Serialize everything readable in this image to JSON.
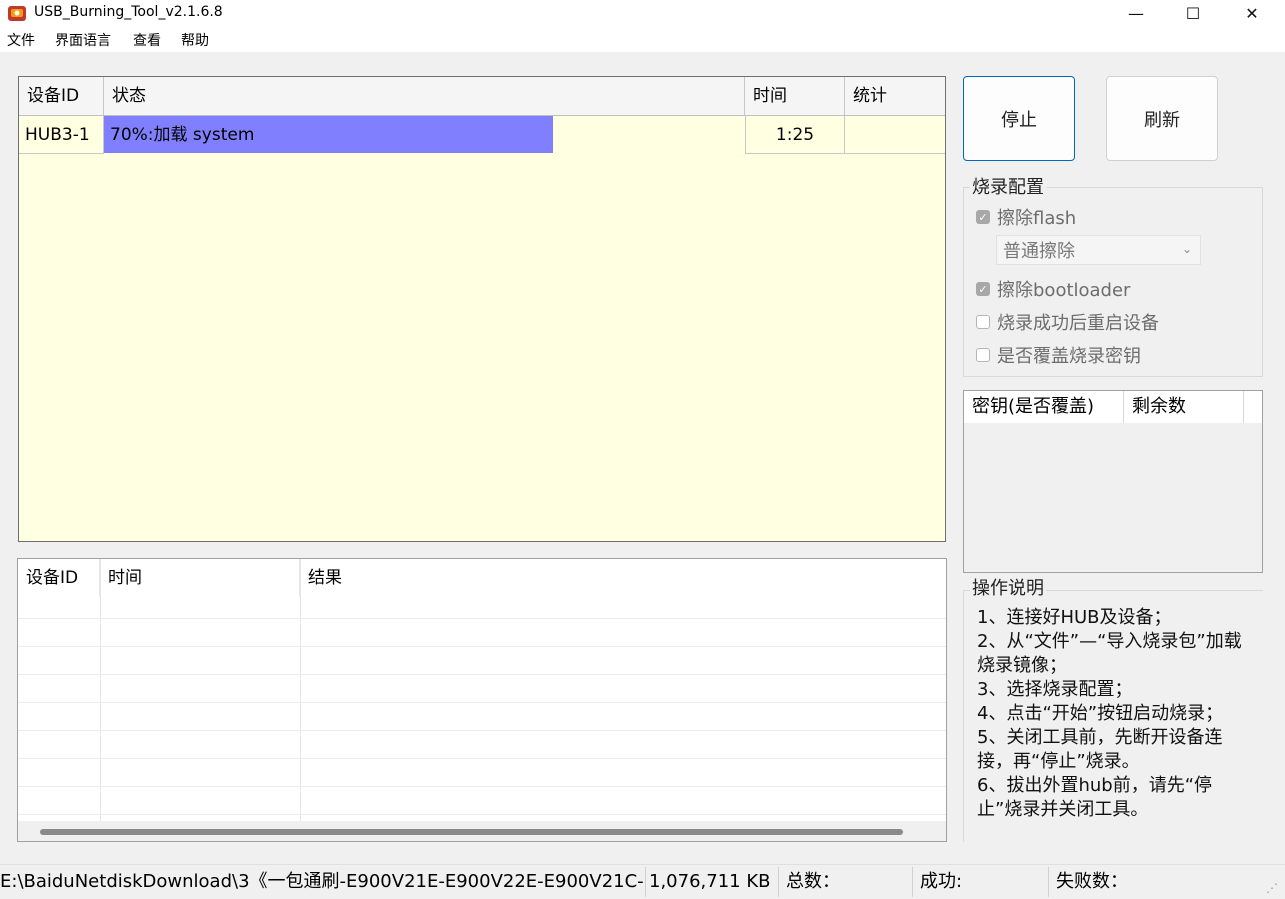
{
  "window": {
    "title": "USB_Burning_Tool_v2.1.6.8",
    "minimize_glyph": "—",
    "maximize_glyph": "☐",
    "close_glyph": "✕"
  },
  "menu": {
    "items": [
      "文件",
      "界面语言",
      "查看",
      "帮助"
    ]
  },
  "device_table": {
    "columns": [
      "设备ID",
      "状态",
      "时间",
      "统计"
    ],
    "rows": [
      {
        "device_id": "HUB3-1",
        "status": "70%:加载 system",
        "progress": 0.7,
        "time": "1:25",
        "stats": ""
      }
    ],
    "progress_color": "#8080ff",
    "background_color": "#ffffe1"
  },
  "result_table": {
    "columns": [
      "设备ID",
      "时间",
      "结果"
    ]
  },
  "buttons": {
    "stop": "停止",
    "refresh": "刷新"
  },
  "burn_config": {
    "title": "烧录配置",
    "erase_flash": {
      "label": "擦除flash",
      "checked": true
    },
    "erase_mode": "普通擦除",
    "erase_bootloader": {
      "label": "擦除bootloader",
      "checked": true
    },
    "reboot_after": {
      "label": "烧录成功后重启设备",
      "checked": false
    },
    "overwrite_key": {
      "label": "是否覆盖烧录密钥",
      "checked": false
    }
  },
  "key_table": {
    "columns": [
      "密钥(是否覆盖)",
      "剩余数"
    ]
  },
  "instructions": {
    "title": "操作说明",
    "lines": [
      "1、连接好HUB及设备；",
      "2、从“文件”—“导入烧录包”加载烧录镜像；",
      "3、选择烧录配置；",
      "4、点击“开始”按钮启动烧录；",
      "5、关闭工具前，先断开设备连接，再“停止”烧录。",
      "6、拔出外置hub前，请先“停止”烧录并关闭工具。"
    ]
  },
  "statusbar": {
    "path": "E:\\BaiduNetdiskDownload\\3《一包通刷-E900V21E-E900V22E-E900V21C-",
    "size": "1,076,711 KB",
    "total_label": "总数：",
    "success_label": "成功:",
    "fail_label": "失败数："
  }
}
